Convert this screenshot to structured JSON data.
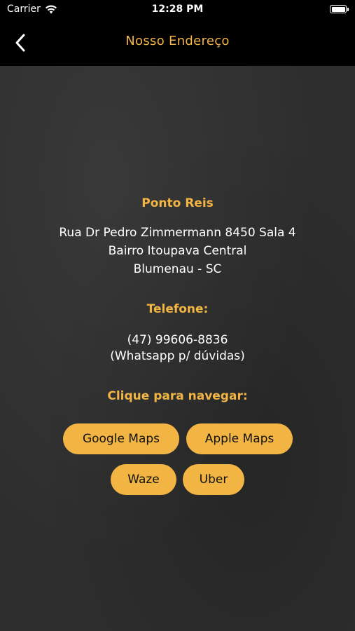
{
  "status_bar": {
    "carrier": "Carrier",
    "time": "12:28 PM"
  },
  "nav": {
    "title": "Nosso Endereço",
    "back_icon": "chevron-left-icon"
  },
  "place": {
    "name": "Ponto Reis",
    "address_line1": "Rua Dr Pedro Zimmermann 8450 Sala 4",
    "address_line2": "Bairro Itoupava Central",
    "address_line3": "Blumenau - SC"
  },
  "phone": {
    "title": "Telefone:",
    "number": "(47) 99606-8836",
    "note": "(Whatsapp p/ dúvidas)"
  },
  "navigate": {
    "title": "Clique para navegar:",
    "google_maps": "Google Maps",
    "apple_maps": "Apple Maps",
    "waze": "Waze",
    "uber": "Uber"
  },
  "colors": {
    "accent": "#f2b544",
    "background": "#2e2e2e",
    "bar": "#000000"
  }
}
